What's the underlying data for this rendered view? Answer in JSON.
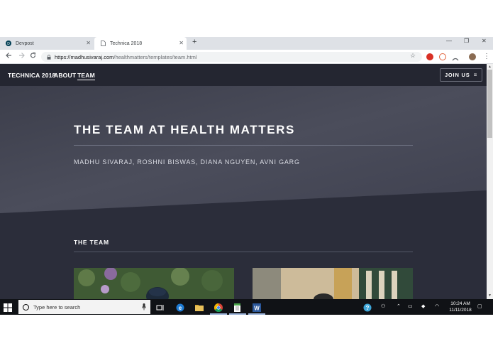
{
  "browser": {
    "tabs": [
      {
        "label": "Devpost",
        "active": false
      },
      {
        "label": "Technica 2018",
        "active": true
      }
    ],
    "new_tab_symbol": "+",
    "close_symbol": "✕",
    "window_controls": {
      "minimize": "—",
      "restore": "❐",
      "close": "✕"
    },
    "url_host": "https://madhusivaraj.com",
    "url_path": "/healthmatters/templates/team.html",
    "extension_icons": [
      "adblock-icon",
      "extension-icon",
      "mirror-icon",
      "profile-avatar"
    ],
    "menu_symbol": "⋮"
  },
  "site": {
    "nav": {
      "brand": "TECHNICA 2018",
      "about": "ABOUT",
      "team": "TEAM",
      "join": "JOIN US"
    },
    "hero": {
      "title": "THE TEAM AT HEALTH MATTERS",
      "subtitle": "MADHU SIVARAJ, ROSHNI BISWAS, DIANA NGUYEN, AVNI GARG"
    },
    "section": {
      "title": "THE TEAM"
    },
    "colors": {
      "nav_bg": "#242631",
      "hero_bg": "#4a4c5a",
      "page_bg": "#2b2d3a"
    }
  },
  "taskbar": {
    "search_placeholder": "Type here to search",
    "time": "10:24 AM",
    "date": "11/11/2018",
    "pinned": [
      "task-view-icon",
      "edge-icon",
      "file-explorer-icon",
      "chrome-icon",
      "notepad-icon",
      "word-icon"
    ]
  }
}
